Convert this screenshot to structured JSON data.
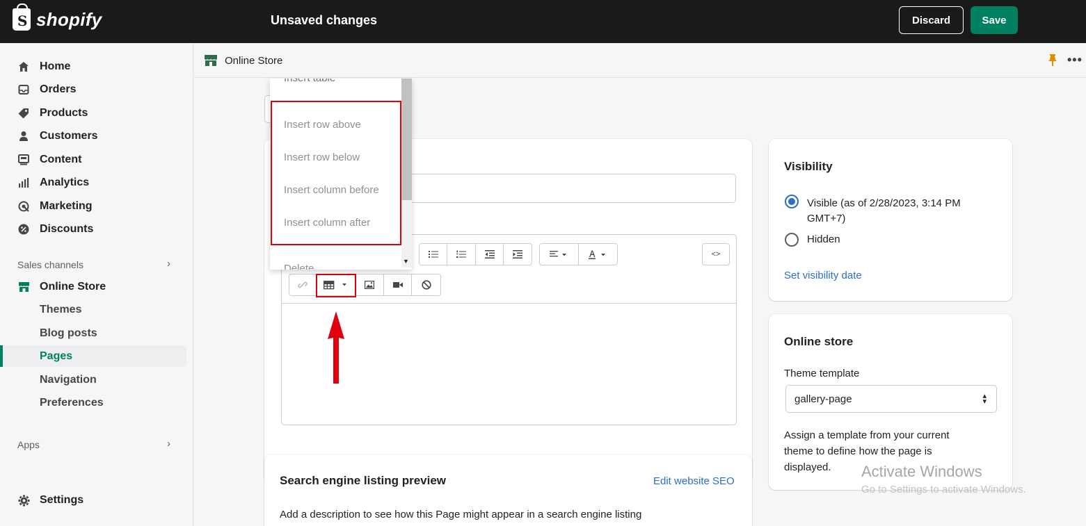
{
  "topbar": {
    "brand": "shopify",
    "status": "Unsaved changes",
    "discard_label": "Discard",
    "save_label": "Save"
  },
  "sidebar": {
    "items": [
      {
        "label": "Home",
        "icon": "home-icon"
      },
      {
        "label": "Orders",
        "icon": "orders-icon"
      },
      {
        "label": "Products",
        "icon": "tag-icon"
      },
      {
        "label": "Customers",
        "icon": "person-icon"
      },
      {
        "label": "Content",
        "icon": "content-icon"
      },
      {
        "label": "Analytics",
        "icon": "bar-chart-icon"
      },
      {
        "label": "Marketing",
        "icon": "marketing-icon"
      },
      {
        "label": "Discounts",
        "icon": "discount-icon"
      }
    ],
    "sales_channels_label": "Sales channels",
    "online_store_label": "Online Store",
    "online_store_subitems": [
      "Themes",
      "Blog posts",
      "Pages",
      "Navigation",
      "Preferences"
    ],
    "active_subitem": "Pages",
    "apps_label": "Apps",
    "settings_label": "Settings"
  },
  "breadcrumb": {
    "label": "Online Store"
  },
  "dropdown": {
    "items": [
      "Insert table",
      "Insert row above",
      "Insert row below",
      "Insert column before",
      "Insert column after",
      "Delete"
    ]
  },
  "editor": {
    "code_toggle_label": "<>"
  },
  "visibility": {
    "title": "Visibility",
    "visible_label": "Visible (as of 2/28/2023, 3:14 PM GMT+7)",
    "visible_line1": "Visible (as of 2/28/2023, 3:14 PM",
    "visible_line2": "GMT+7)",
    "hidden_label": "Hidden",
    "set_date_link": "Set visibility date",
    "selected": "visible"
  },
  "online_store_card": {
    "title": "Online store",
    "template_label": "Theme template",
    "template_value": "gallery-page",
    "help_line1": "Assign a template from your current",
    "help_line2": "theme to define how the page is",
    "help_line3": "displayed."
  },
  "seo": {
    "title": "Search engine listing preview",
    "edit_link": "Edit website SEO",
    "description": "Add a description to see how this Page might appear in a search engine listing"
  },
  "watermark": {
    "line1": "Activate Windows",
    "line2": "Go to Settings to activate Windows."
  },
  "colors": {
    "topbar_bg": "#1a1a1a",
    "save_green": "#008060",
    "active_nav": "#007f5f",
    "link_blue": "#2c6ecb",
    "annotation_red": "#e0000b"
  }
}
